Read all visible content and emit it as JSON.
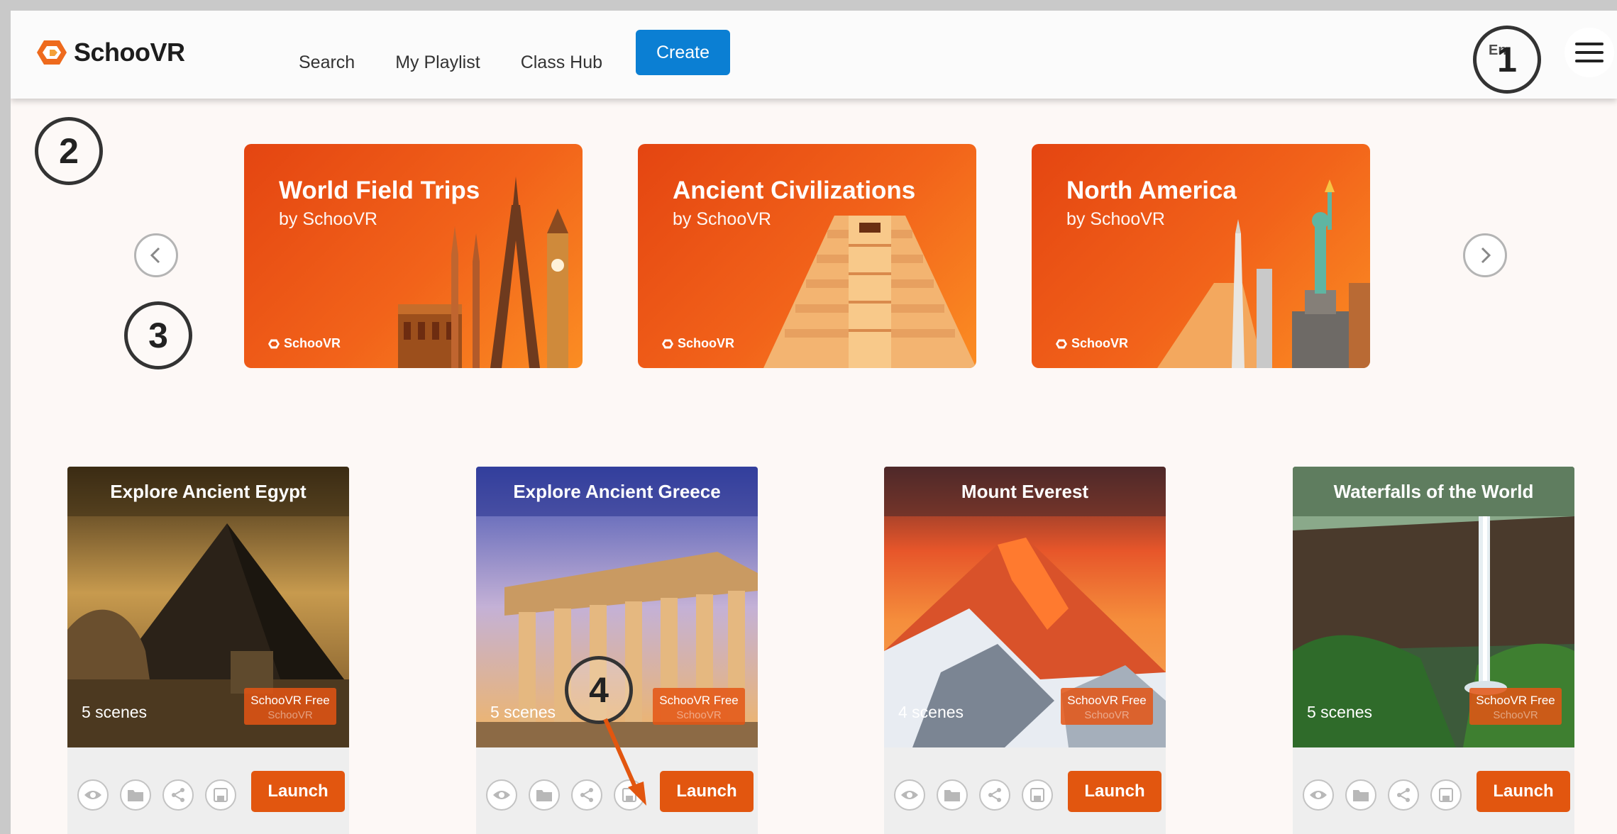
{
  "app": {
    "name": "SchooVR"
  },
  "nav": {
    "links": [
      "Search",
      "My Playlist",
      "Class Hub"
    ],
    "create_label": "Create",
    "language": "En"
  },
  "annotations": [
    "1",
    "2",
    "3",
    "4"
  ],
  "banners": [
    {
      "title": "World Field Trips",
      "subtitle": "by SchooVR",
      "brand": "SchooVR"
    },
    {
      "title": "Ancient Civilizations",
      "subtitle": "by SchooVR",
      "brand": "SchooVR"
    },
    {
      "title": "North America",
      "subtitle": "by SchooVR",
      "brand": "SchooVR"
    }
  ],
  "cards": [
    {
      "title": "Explore Ancient Egypt",
      "scenes": "5 scenes",
      "badge": "SchooVR Free",
      "badge_ghost": "SchooVR",
      "launch": "Launch"
    },
    {
      "title": "Explore Ancient Greece",
      "scenes": "5 scenes",
      "badge": "SchooVR Free",
      "badge_ghost": "SchooVR",
      "launch": "Launch"
    },
    {
      "title": "Mount Everest",
      "scenes": "4 scenes",
      "badge": "SchooVR Free",
      "badge_ghost": "SchooVR",
      "launch": "Launch"
    },
    {
      "title": "Waterfalls of the World",
      "scenes": "5 scenes",
      "badge": "SchooVR Free",
      "badge_ghost": "SchooVR",
      "launch": "Launch"
    }
  ],
  "card_icons": [
    "eye-icon",
    "folder-icon",
    "share-icon",
    "save-icon"
  ],
  "colors": {
    "brand_orange": "#e2560f",
    "create_blue": "#0b7fd3"
  }
}
